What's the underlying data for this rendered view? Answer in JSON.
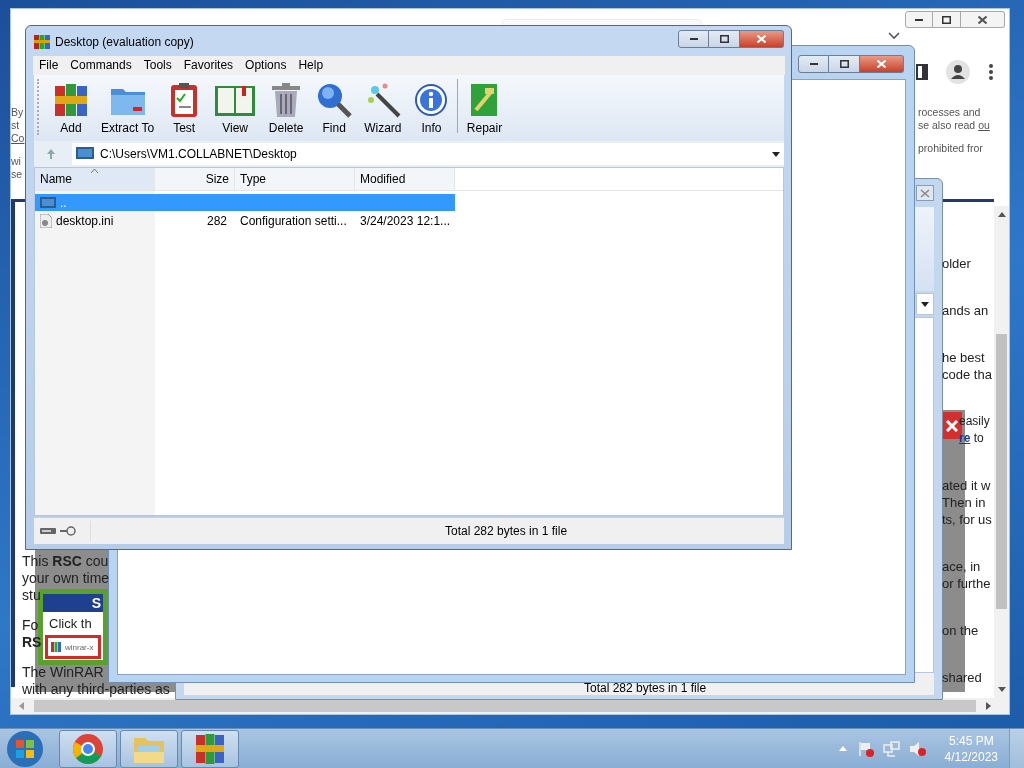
{
  "browser": {
    "page": {
      "left_top": [
        [
          "By",
          "st",
          {
            "link": "Co"
          }
        ],
        [
          "wi",
          "se"
        ]
      ],
      "right_top": [
        [
          "rocesses and",
          {
            "text": "se also read ",
            "link": "ou"
          }
        ],
        [
          "prohibited fror"
        ]
      ],
      "left_body": [
        [
          "This **RSC** cou",
          "your own time",
          "stu"
        ],
        [
          "Fo",
          "**RS**"
        ],
        [
          "The WinRAR",
          "with any third-parties as"
        ]
      ],
      "right_body": [
        [
          "older"
        ],
        [
          "ands an"
        ],
        [
          "he best",
          "code tha"
        ],
        [
          "easily",
          {
            "link": "re",
            "text_after": " to"
          }
        ],
        [
          "ated it w",
          "Then in",
          "ts, for us"
        ],
        [
          "ace, in",
          "or furthe"
        ],
        [
          "on the"
        ],
        [
          "shared"
        ]
      ],
      "popup": {
        "heading": "S",
        "text": "Click th",
        "file": "winrar-x"
      }
    }
  },
  "background_window": {
    "status": "Total 282 bytes in 1 file"
  },
  "archive_window": {
    "title": "Desktop (evaluation copy)",
    "menu": [
      "File",
      "Commands",
      "Tools",
      "Favorites",
      "Options",
      "Help"
    ],
    "toolbar": [
      {
        "label": "Add",
        "kind": "add"
      },
      {
        "label": "Extract To",
        "kind": "extract"
      },
      {
        "label": "Test",
        "kind": "test"
      },
      {
        "label": "View",
        "kind": "view"
      },
      {
        "label": "Delete",
        "kind": "delete"
      },
      {
        "label": "Find",
        "kind": "find"
      },
      {
        "label": "Wizard",
        "kind": "wizard"
      },
      {
        "label": "Info",
        "kind": "info"
      },
      {
        "label": "Repair",
        "kind": "repair"
      }
    ],
    "path": "C:\\Users\\VM1.COLLABNET\\Desktop",
    "columns": [
      {
        "label": "Name",
        "sorted": true
      },
      {
        "label": "Size",
        "sorted": false
      },
      {
        "label": "Type",
        "sorted": false
      },
      {
        "label": "Modified",
        "sorted": false
      }
    ],
    "rows": [
      {
        "kind": "parent",
        "name": "..",
        "selected": true
      },
      {
        "kind": "file",
        "name": "desktop.ini",
        "size": "282",
        "type": "Configuration setti...",
        "modified": "3/24/2023 12:1...",
        "selected": false
      }
    ],
    "status": "Total 282 bytes in 1 file"
  },
  "taskbar": {
    "apps": [
      {
        "kind": "browser"
      },
      {
        "kind": "folder"
      },
      {
        "kind": "archiver"
      }
    ],
    "time": "5:45 PM",
    "date": "4/12/2023"
  }
}
